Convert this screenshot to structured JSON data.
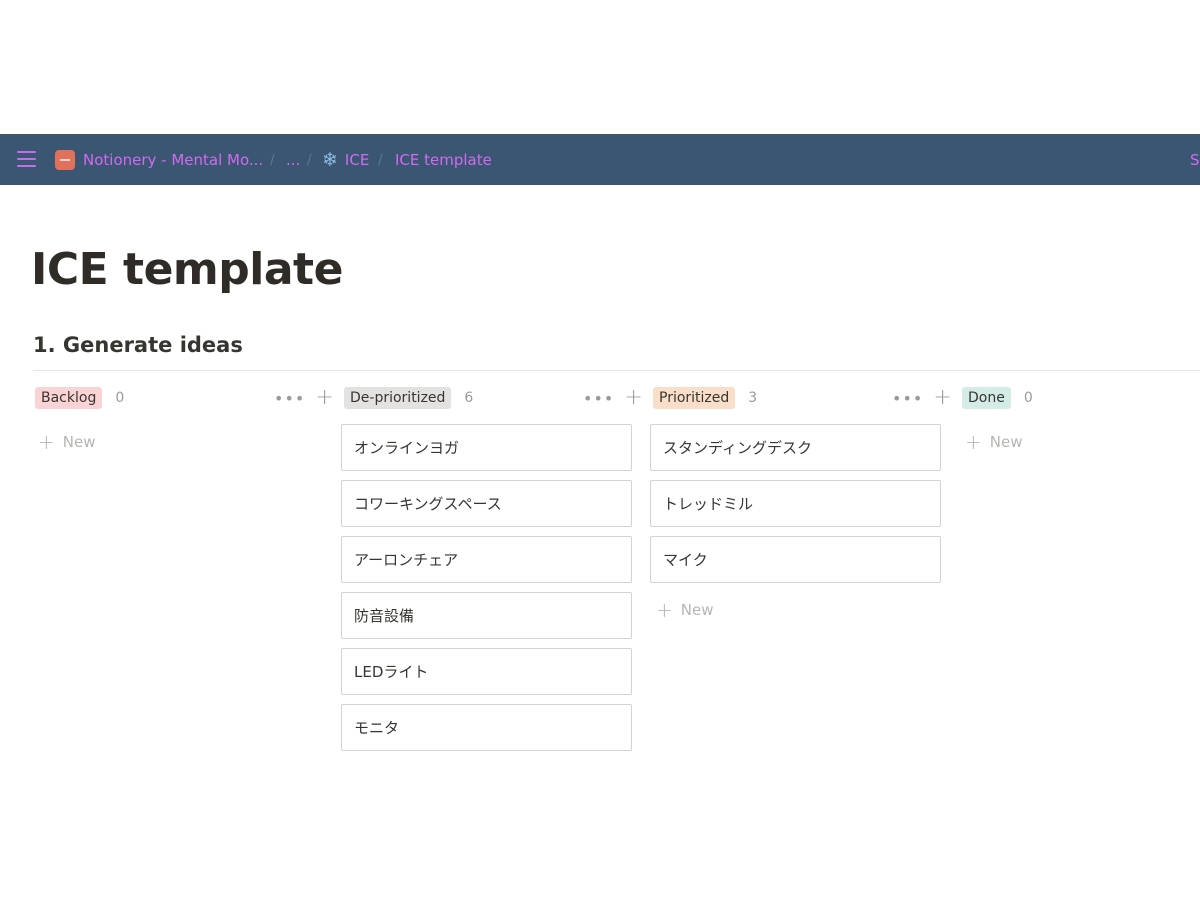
{
  "topbar": {
    "breadcrumbs": [
      {
        "label": "Notionery - Mental Mo...",
        "icon": "workspace-icon"
      },
      {
        "label": "..."
      },
      {
        "label": "ICE",
        "icon": "snowflake-icon"
      },
      {
        "label": "ICE template"
      }
    ],
    "right_text": "S"
  },
  "page": {
    "title": "ICE template",
    "section_title": "1. Generate ideas"
  },
  "board": {
    "new_label": "New",
    "columns": [
      {
        "name": "Backlog",
        "count": "0",
        "color": "#fbd3d4",
        "cards": []
      },
      {
        "name": "De-prioritized",
        "count": "6",
        "color": "#e3e2e0",
        "cards": [
          "オンラインヨガ",
          "コワーキングスペース",
          "アーロンチェア",
          "防音設備",
          "LEDライト",
          "モニタ"
        ]
      },
      {
        "name": "Prioritized",
        "count": "3",
        "color": "#fadec9",
        "cards": [
          "スタンディングデスク",
          "トレッドミル",
          "マイク"
        ]
      },
      {
        "name": "Done",
        "count": "0",
        "color": "#d3ece6",
        "cards": []
      }
    ]
  },
  "colors": {
    "topbar_bg": "#3a5672",
    "link_text": "#d16af0"
  }
}
